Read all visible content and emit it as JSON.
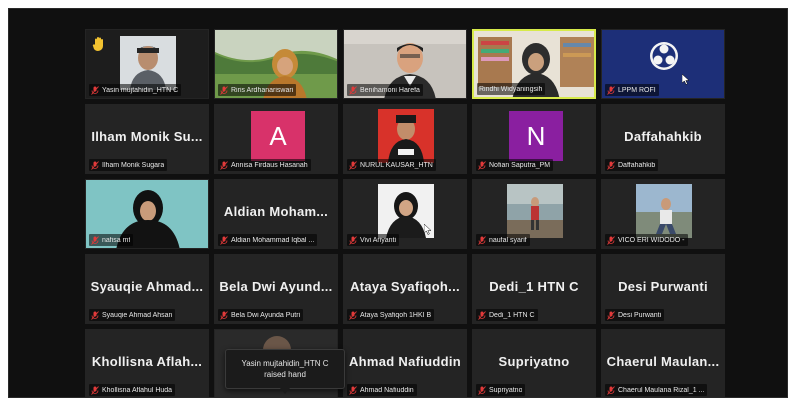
{
  "icons": {
    "mic_muted": "mic-muted-icon",
    "raised_hand": "raised-hand-icon",
    "obs_logo": "obs-logo-icon",
    "cursor": "cursor-icon"
  },
  "colors": {
    "active_speaker_border": "#d7ea4a",
    "mute_red": "#e23a3a",
    "hand_yellow": "#f2c230",
    "avatar_a": "#d8326a",
    "avatar_n": "#8a1fa0",
    "obs_blue": "#1d2f78"
  },
  "participants": [
    {
      "label": "Yasin mujtahidin_HTN C",
      "big": "",
      "hand": true
    },
    {
      "label": "Riris Ardhanariswari",
      "big": ""
    },
    {
      "label": "Benihamoni Harefa",
      "big": ""
    },
    {
      "label": "Rindhi Widyaningsih",
      "big": "",
      "active": true
    },
    {
      "label": "LPPM ROFI",
      "big": ""
    },
    {
      "label": "Ilham Monik Sugara",
      "big": "Ilham Monik Su..."
    },
    {
      "label": "Annisa Firdaus Hasanah",
      "big": "",
      "avatar": "A"
    },
    {
      "label": "NURUL KAUSAR_HTN",
      "big": ""
    },
    {
      "label": "Nofian Saputra_PM",
      "big": "",
      "avatar": "N"
    },
    {
      "label": "Daffahahkib",
      "big": "Daffahahkib"
    },
    {
      "label": "nafisa mt",
      "big": ""
    },
    {
      "label": "Aldian Mohammad Iqbal ...",
      "big": "Aldian Moham..."
    },
    {
      "label": "Vivi Ariyanti",
      "big": ""
    },
    {
      "label": "naufal syarif",
      "big": ""
    },
    {
      "label": "VICO ERI WIDODO -",
      "big": ""
    },
    {
      "label": "Syauqie Ahmad Ahsan",
      "big": "Syauqie Ahmad..."
    },
    {
      "label": "Bela Dwi Ayunda Putri",
      "big": "Bela Dwi Ayund..."
    },
    {
      "label": "Ataya Syafiqoh 1HKI B",
      "big": "Ataya Syafiqoh..."
    },
    {
      "label": "Dedi_1 HTN C",
      "big": "Dedi_1 HTN C"
    },
    {
      "label": "Desi Purwanti",
      "big": "Desi Purwanti"
    },
    {
      "label": "Khollisna Aflahul Huda",
      "big": "Khollisna Aflah..."
    },
    {
      "label": "",
      "big": ""
    },
    {
      "label": "Ahmad Nafiuddin",
      "big": "Ahmad Nafiuddin"
    },
    {
      "label": "Supriyatno",
      "big": "Supriyatno"
    },
    {
      "label": "Chaerul Maulana Rizal_1 ...",
      "big": "Chaerul Maulan..."
    }
  ],
  "tooltip": {
    "line1": "Yasin mujtahidin_HTN C",
    "line2": "raised hand"
  }
}
